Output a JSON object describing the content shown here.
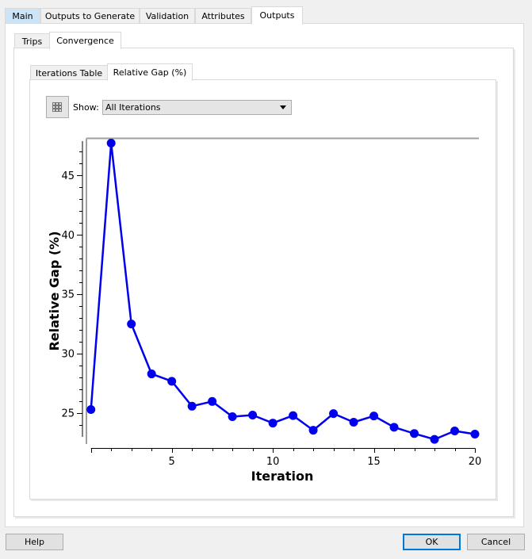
{
  "top_tabs": [
    {
      "label": "Main"
    },
    {
      "label": "Outputs to Generate"
    },
    {
      "label": "Validation"
    },
    {
      "label": "Attributes"
    },
    {
      "label": "Outputs"
    }
  ],
  "sub_tabs": [
    {
      "label": "Trips"
    },
    {
      "label": "Convergence"
    }
  ],
  "inner_tabs": [
    {
      "label": "Iterations Table"
    },
    {
      "label": "Relative Gap (%)"
    }
  ],
  "toolbar": {
    "grid_icon": "grid-icon",
    "show_label": "Show:",
    "show_value": "All Iterations"
  },
  "footer": {
    "help_label": "Help",
    "ok_label": "OK",
    "cancel_label": "Cancel"
  },
  "colors": {
    "series": "#0000ee",
    "accent": "#0078d7"
  },
  "chart_data": {
    "type": "line",
    "title": "",
    "xlabel": "Iteration",
    "ylabel": "Relative Gap (%)",
    "x": [
      1,
      2,
      3,
      4,
      5,
      6,
      7,
      8,
      9,
      10,
      11,
      12,
      13,
      14,
      15,
      16,
      17,
      18,
      19,
      20
    ],
    "series": [
      {
        "name": "Relative Gap (%)",
        "values": [
          25.27,
          47.7,
          32.47,
          28.27,
          27.65,
          25.55,
          25.95,
          24.67,
          24.8,
          24.13,
          24.76,
          23.53,
          24.93,
          24.2,
          24.73,
          23.78,
          23.25,
          22.76,
          23.47,
          23.2
        ]
      }
    ],
    "xlim": [
      1,
      20
    ],
    "ylim": [
      22.9,
      48.1
    ],
    "xticks": [
      5,
      10,
      15,
      20
    ],
    "yticks": [
      25,
      30,
      35,
      40,
      45
    ],
    "grid": false,
    "legend": "none"
  }
}
